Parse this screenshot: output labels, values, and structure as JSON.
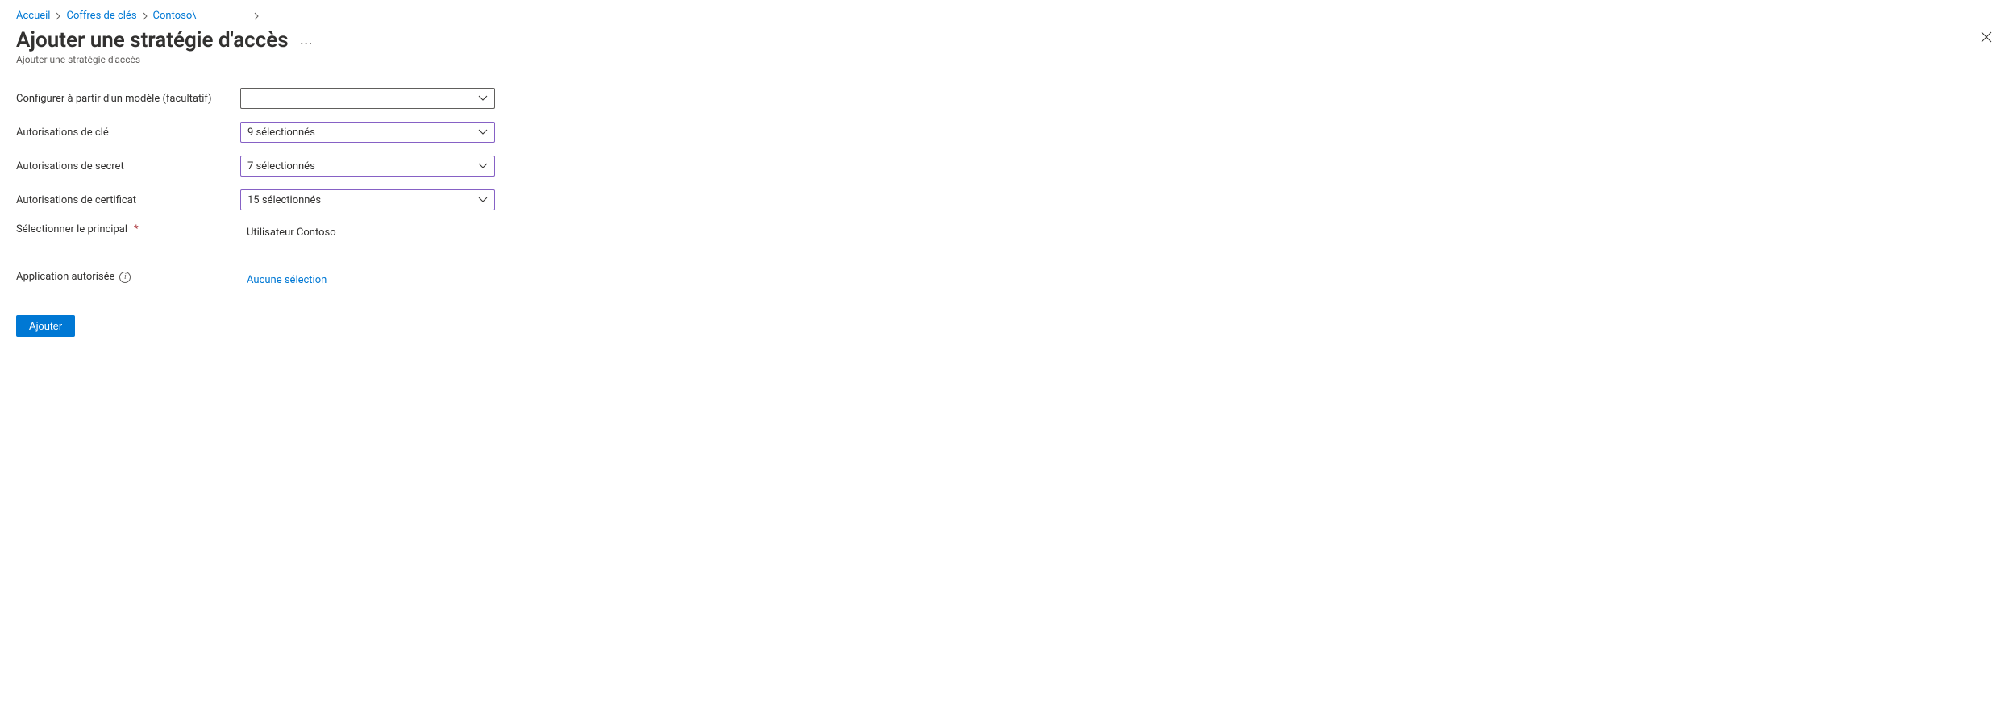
{
  "breadcrumb": {
    "items": [
      {
        "label": "Accueil"
      },
      {
        "label": "Coffres de clés"
      },
      {
        "label": "Contoso\\"
      }
    ]
  },
  "header": {
    "title": "Ajouter une stratégie d'accès",
    "subtitle": "Ajouter une stratégie d'accès"
  },
  "form": {
    "template": {
      "label": "Configurer à partir d'un modèle (facultatif)",
      "value": ""
    },
    "key_perms": {
      "label": "Autorisations de clé",
      "value": "9 sélectionnés"
    },
    "secret_perms": {
      "label": "Autorisations de secret",
      "value": "7 sélectionnés"
    },
    "cert_perms": {
      "label": "Autorisations de certificat",
      "value": "15 sélectionnés"
    },
    "principal": {
      "label": "Sélectionner le principal",
      "value": "Utilisateur Contoso"
    },
    "authorized_app": {
      "label": "Application autorisée",
      "value": "Aucune sélection"
    }
  },
  "actions": {
    "add": "Ajouter"
  }
}
